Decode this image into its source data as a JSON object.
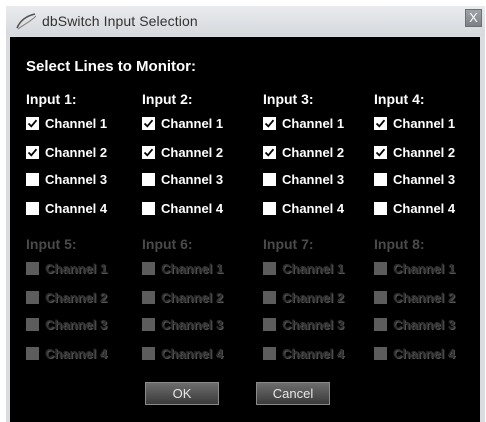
{
  "window": {
    "title": "dbSwitch Input Selection",
    "close_label": "X"
  },
  "heading": "Select Lines to Monitor:",
  "groups": [
    {
      "label": "Input 1:",
      "enabled": true,
      "channels": [
        {
          "label": "Channel 1",
          "checked": true
        },
        {
          "label": "Channel 2",
          "checked": true
        },
        {
          "label": "Channel 3",
          "checked": false
        },
        {
          "label": "Channel 4",
          "checked": false
        }
      ]
    },
    {
      "label": "Input 2:",
      "enabled": true,
      "channels": [
        {
          "label": "Channel 1",
          "checked": true
        },
        {
          "label": "Channel 2",
          "checked": true
        },
        {
          "label": "Channel 3",
          "checked": false
        },
        {
          "label": "Channel 4",
          "checked": false
        }
      ]
    },
    {
      "label": "Input 3:",
      "enabled": true,
      "channels": [
        {
          "label": "Channel 1",
          "checked": true
        },
        {
          "label": "Channel 2",
          "checked": true
        },
        {
          "label": "Channel 3",
          "checked": false
        },
        {
          "label": "Channel 4",
          "checked": false
        }
      ]
    },
    {
      "label": "Input 4:",
      "enabled": true,
      "channels": [
        {
          "label": "Channel 1",
          "checked": true
        },
        {
          "label": "Channel 2",
          "checked": true
        },
        {
          "label": "Channel 3",
          "checked": false
        },
        {
          "label": "Channel 4",
          "checked": false
        }
      ]
    },
    {
      "label": "Input 5:",
      "enabled": false,
      "channels": [
        {
          "label": "Channel 1",
          "checked": false
        },
        {
          "label": "Channel 2",
          "checked": false
        },
        {
          "label": "Channel 3",
          "checked": false
        },
        {
          "label": "Channel 4",
          "checked": false
        }
      ]
    },
    {
      "label": "Input 6:",
      "enabled": false,
      "channels": [
        {
          "label": "Channel 1",
          "checked": false
        },
        {
          "label": "Channel 2",
          "checked": false
        },
        {
          "label": "Channel 3",
          "checked": false
        },
        {
          "label": "Channel 4",
          "checked": false
        }
      ]
    },
    {
      "label": "Input 7:",
      "enabled": false,
      "channels": [
        {
          "label": "Channel 1",
          "checked": false
        },
        {
          "label": "Channel 2",
          "checked": false
        },
        {
          "label": "Channel 3",
          "checked": false
        },
        {
          "label": "Channel 4",
          "checked": false
        }
      ]
    },
    {
      "label": "Input 8:",
      "enabled": false,
      "channels": [
        {
          "label": "Channel 1",
          "checked": false
        },
        {
          "label": "Channel 2",
          "checked": false
        },
        {
          "label": "Channel 3",
          "checked": false
        },
        {
          "label": "Channel 4",
          "checked": false
        }
      ]
    }
  ],
  "buttons": {
    "ok": "OK",
    "cancel": "Cancel"
  },
  "colors": {
    "panel_background": "#000000",
    "enabled_text": "#ffffff",
    "disabled_text": "#2e2e2e",
    "titlebar": "#dadce0"
  },
  "icons": {
    "title_icon": "swoosh-logo-icon",
    "checkmark": "checkmark-icon"
  }
}
